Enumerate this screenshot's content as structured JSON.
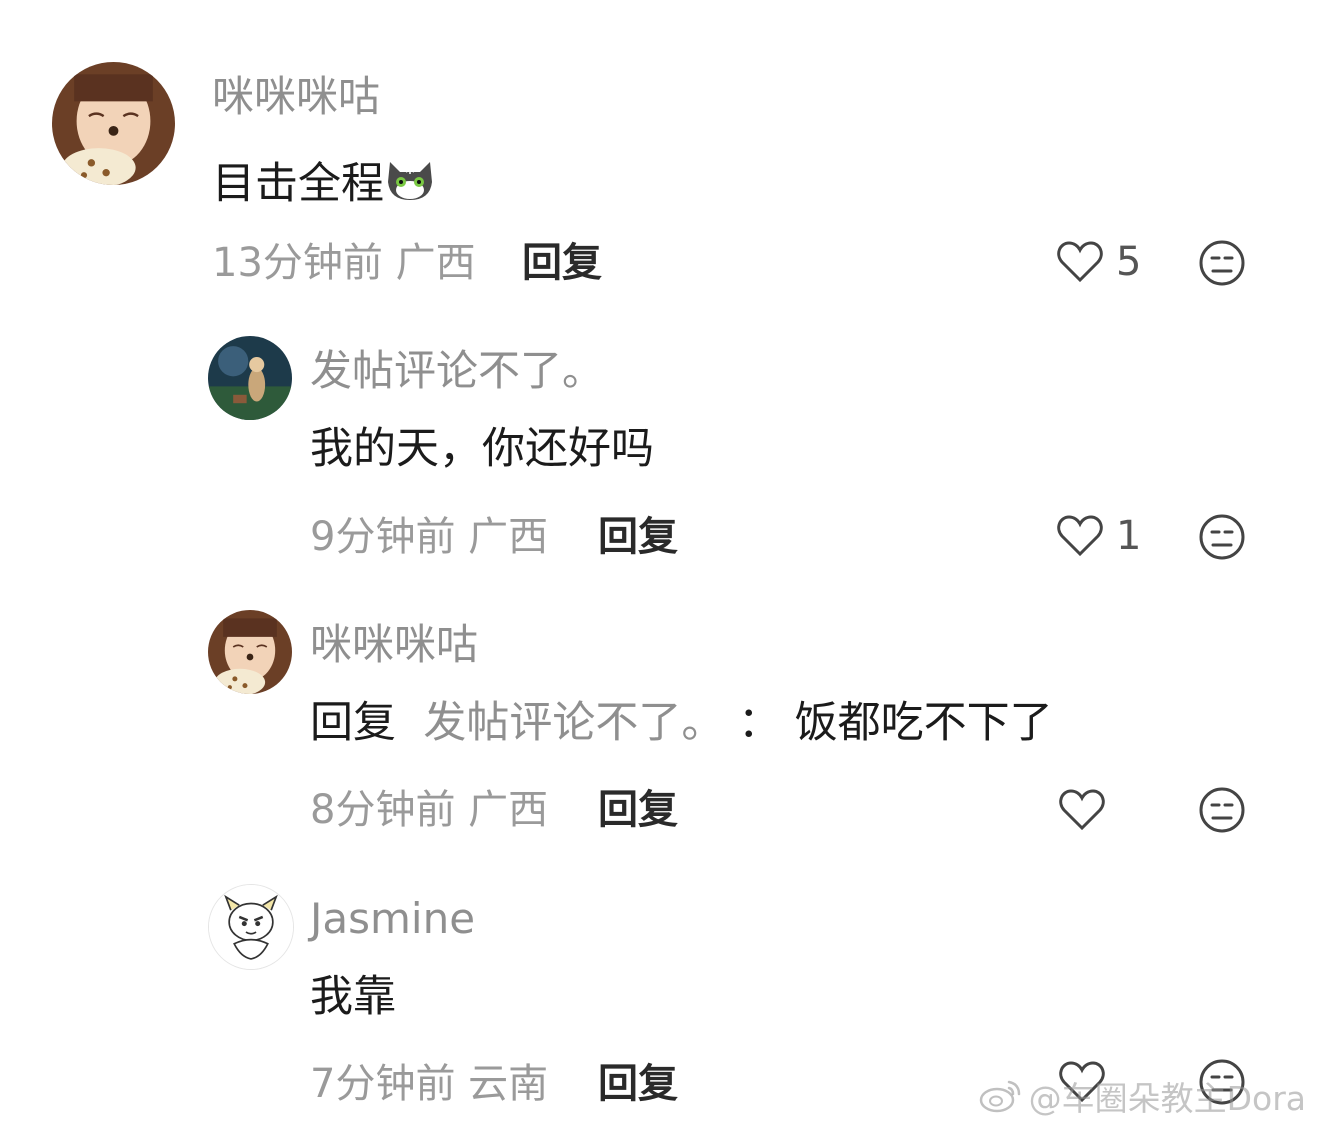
{
  "comments": [
    {
      "username": "咪咪咪咕",
      "text": "目击全程",
      "time": "13分钟前",
      "location": "广西",
      "reply_label": "回复",
      "likes": "5"
    },
    {
      "username": "发帖评论不了。",
      "text": "我的天，你还好吗",
      "time": "9分钟前",
      "location": "广西",
      "reply_label": "回复",
      "likes": "1"
    },
    {
      "username": "咪咪咪咕",
      "reply_prefix": "回复",
      "reply_to": "发帖评论不了。",
      "separator": "：",
      "text": "饭都吃不下了",
      "time": "8分钟前",
      "location": "广西",
      "reply_label": "回复",
      "likes": ""
    },
    {
      "username": "Jasmine",
      "text": "我靠",
      "time": "7分钟前",
      "location": "云南",
      "reply_label": "回复",
      "likes": ""
    }
  ],
  "watermark": "@车圈朵教主Dora",
  "icons": {
    "like": "heart-icon",
    "emoji": "face-emoji-icon",
    "cat": "cat-emoji",
    "weibo": "weibo-logo-icon"
  },
  "colors": {
    "username": "#8f8f8f",
    "content": "#1b1b1b",
    "meta": "#9a9a9a"
  }
}
